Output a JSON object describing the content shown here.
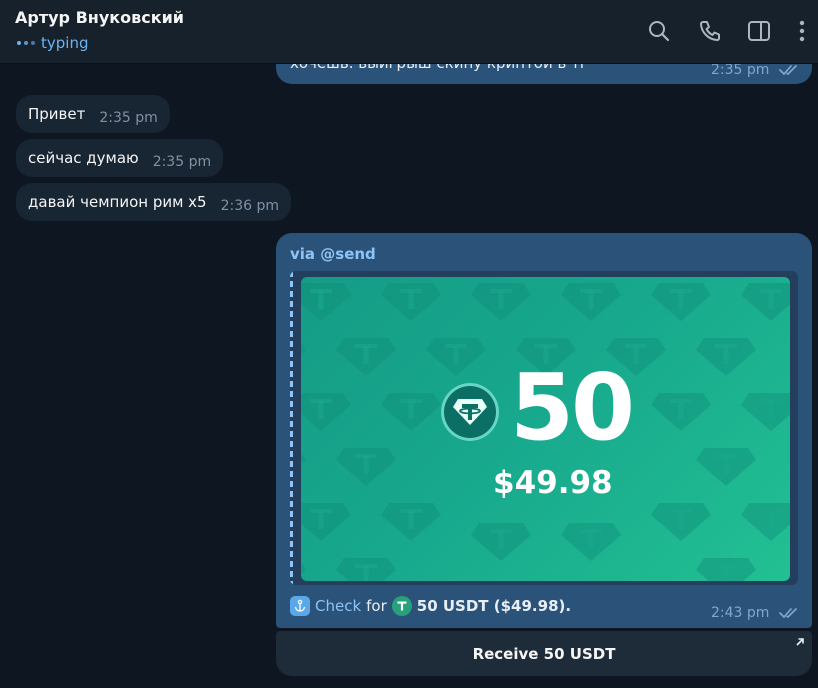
{
  "header": {
    "chat_name": "Артур Внуковский",
    "status": "typing",
    "icons": [
      "search-icon",
      "phone-icon",
      "sidebar-icon",
      "more-icon"
    ]
  },
  "messages": {
    "out_top": {
      "text": "хочешь. выигрыш скину криптой в тг",
      "time": "2:35 pm"
    },
    "incoming": [
      {
        "text": "Привет",
        "time": "2:35 pm"
      },
      {
        "text": "сейчас думаю",
        "time": "2:35 pm"
      },
      {
        "text": "давай чемпион рим x5",
        "time": "2:36 pm"
      }
    ],
    "bot": {
      "via": "via @send",
      "card_amount": "50",
      "card_usd": "$49.98",
      "caption_check": "Check",
      "caption_for": "for",
      "caption_amount": "50 USDT ($49.98).",
      "time": "2:43 pm",
      "button_label": "Receive 50 USDT"
    }
  },
  "colors": {
    "background": "#0e1621",
    "header": "#17212b",
    "incoming_bubble": "#182533",
    "outgoing_bubble": "#2b5278",
    "accent": "#6ab3f3",
    "card_green": "#17a88d"
  }
}
